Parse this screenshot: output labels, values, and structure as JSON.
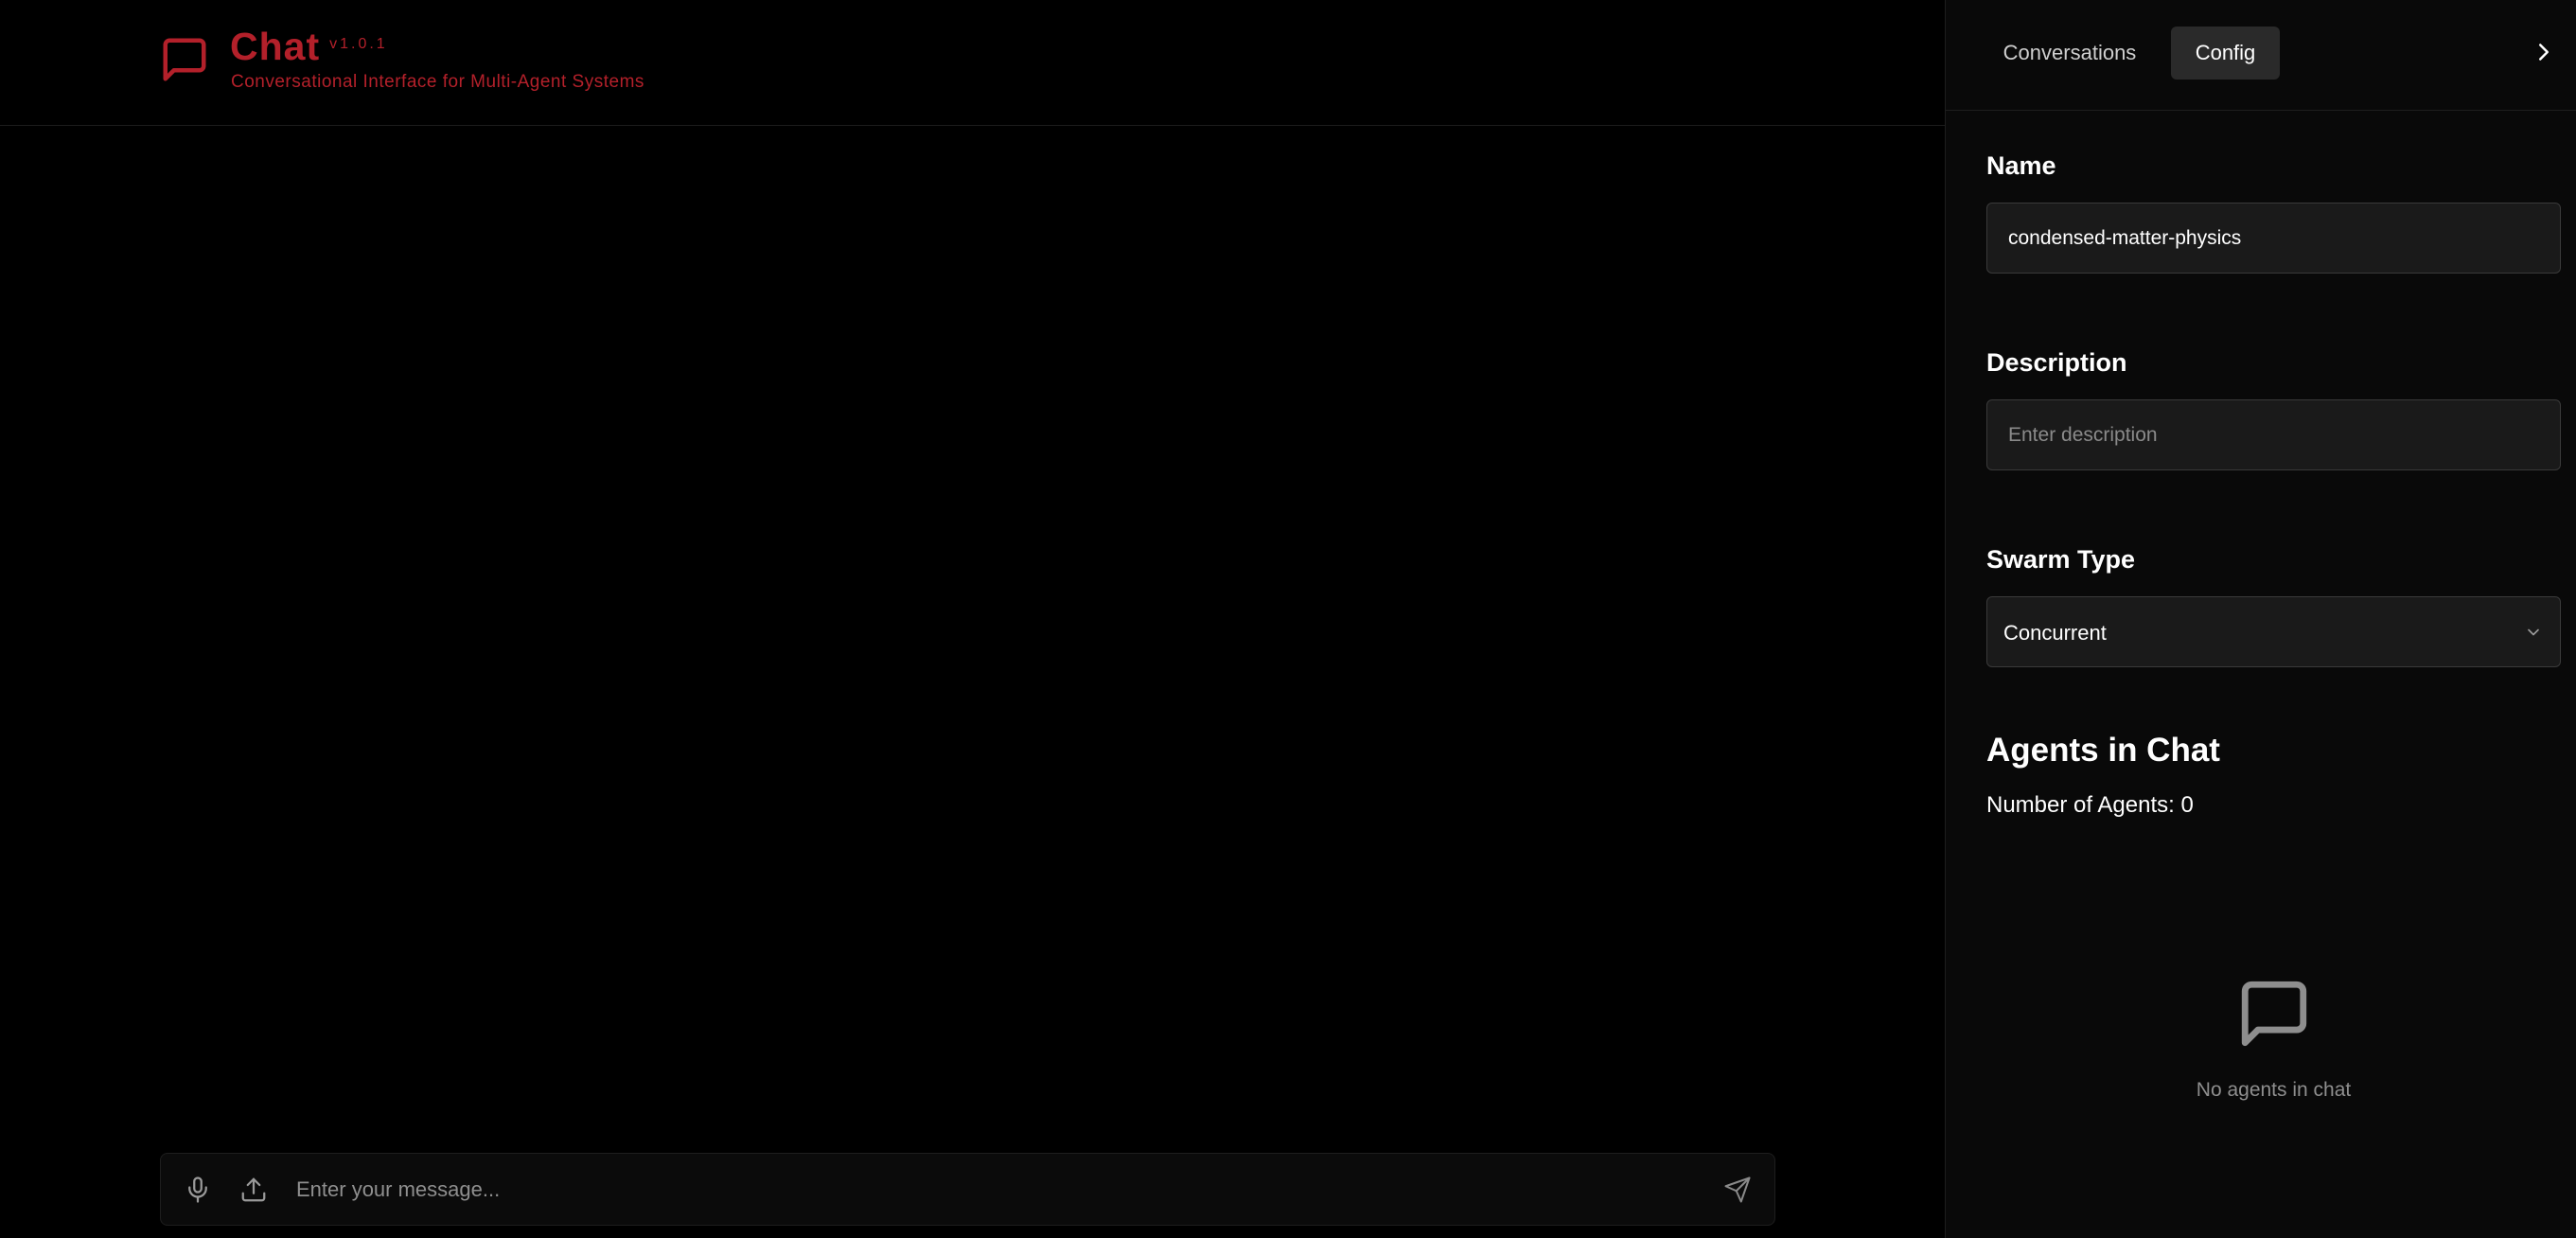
{
  "header": {
    "logo_icon": "chat-bubble-icon",
    "title": "Chat",
    "version": "v1.0.1",
    "subtitle": "Conversational Interface for Multi-Agent Systems",
    "brand_color": "#b3202a"
  },
  "composer": {
    "mic_icon": "microphone-icon",
    "upload_icon": "upload-icon",
    "send_icon": "send-icon",
    "placeholder": "Enter your message...",
    "value": ""
  },
  "panel": {
    "tabs": [
      {
        "label": "Conversations",
        "active": false
      },
      {
        "label": "Config",
        "active": true
      }
    ],
    "collapse_icon": "chevron-right-icon",
    "name": {
      "label": "Name",
      "value": "condensed-matter-physics"
    },
    "description": {
      "label": "Description",
      "placeholder": "Enter description",
      "value": ""
    },
    "swarm_type": {
      "label": "Swarm Type",
      "value": "Concurrent",
      "icon": "chevron-down-icon"
    },
    "agents": {
      "heading": "Agents in Chat",
      "count_text": "Number of Agents: 0",
      "empty_icon": "chat-bubble-icon",
      "empty_text": "No agents in chat"
    }
  }
}
